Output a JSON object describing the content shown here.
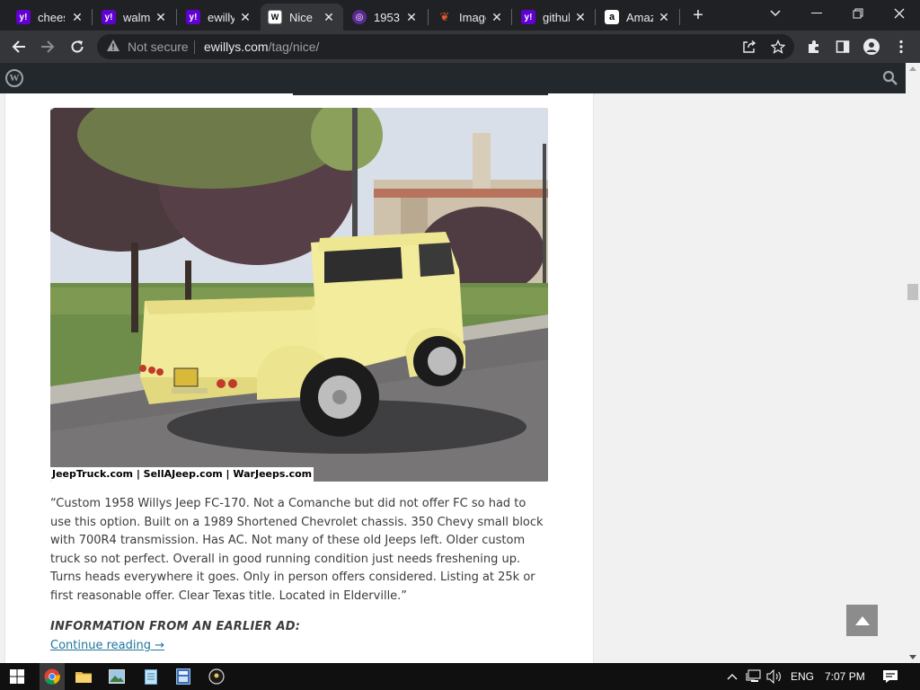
{
  "browser": {
    "tabs": [
      {
        "title": "cheese",
        "favicon": "yahoo-icon",
        "color": "#6001d2",
        "active": false
      },
      {
        "title": "walmart",
        "favicon": "yahoo-icon",
        "color": "#6001d2",
        "active": false
      },
      {
        "title": "ewillys",
        "favicon": "yahoo-icon",
        "color": "#6001d2",
        "active": false
      },
      {
        "title": "Nice",
        "favicon": "ewillys-icon",
        "color": "#ffffff",
        "active": true
      },
      {
        "title": "1953",
        "favicon": "purple-globe-icon",
        "color": "#5b2a91",
        "active": false
      },
      {
        "title": "Image",
        "favicon": "feather-icon",
        "color": "#e2572b",
        "active": false
      },
      {
        "title": "github",
        "favicon": "yahoo-icon",
        "color": "#6001d2",
        "active": false
      },
      {
        "title": "Amazon",
        "favicon": "amazon-icon",
        "color": "#ffffff",
        "active": false
      }
    ],
    "security_label": "Not secure",
    "url_domain": "ewillys.com",
    "url_path": "/tag/nice/"
  },
  "post": {
    "image_watermark": "JeepTruck.com | SellAJeep.com | WarJeeps.com",
    "caption": "“Custom 1958 Willys Jeep FC-170. Not a Comanche but did not offer FC so had to use this option. Built on a 1989 Shortened Chevrolet chassis. 350 Chevy small block with 700R4 transmission. Has AC. Not many of these old Jeeps left. Older custom truck so not perfect. Overall in good running condition just needs freshening up. Turns heads everywhere it goes. Only in person offers considered. Listing at 25k or first reasonable offer. Clear Texas title. Located in Elderville.”",
    "ad_heading": "INFORMATION FROM AN EARLIER AD:",
    "continue_link": "Continue reading →"
  },
  "taskbar": {
    "language": "ENG",
    "time": "7:07 PM"
  },
  "colors": {
    "link": "#21759b",
    "admin_bar": "#23282d",
    "truck_yellow": "#f3ec9c"
  }
}
